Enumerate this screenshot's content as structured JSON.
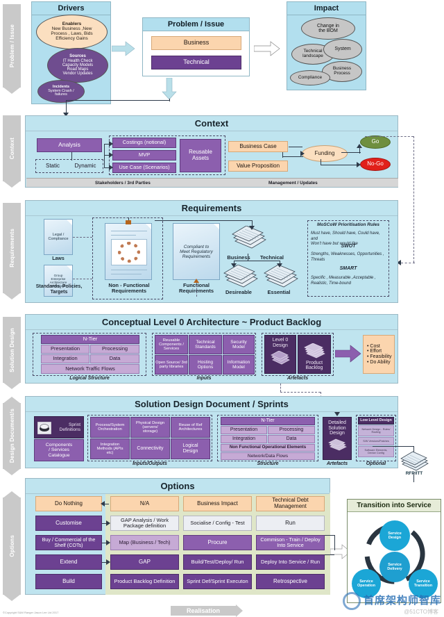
{
  "phases": [
    {
      "key": "problem-issue",
      "label": "Problem / Issue"
    },
    {
      "key": "context",
      "label": "Context"
    },
    {
      "key": "requirements",
      "label": "Requirements"
    },
    {
      "key": "solution-design",
      "label": "Solution Design"
    },
    {
      "key": "design-documents",
      "label": "Design Document/s"
    },
    {
      "key": "options",
      "label": "Options"
    }
  ],
  "drivers": {
    "title": "Drivers",
    "clouds": [
      {
        "heading": "Enablers",
        "lines": [
          "New Business ,New",
          "Process , Laws, Bids",
          "Efficiency Gains"
        ]
      },
      {
        "heading": "Sources",
        "lines": [
          "IT Health Check",
          "Capacity Models",
          "Road Maps",
          "Vendor Updates"
        ]
      },
      {
        "heading": "Incidents",
        "lines": [
          "System Crash /",
          "failures"
        ]
      }
    ]
  },
  "problem_issue": {
    "title": "Problem / Issue",
    "items": [
      {
        "label": "Business",
        "style": "peach"
      },
      {
        "label": "Technical",
        "style": "purple"
      }
    ]
  },
  "impact": {
    "title": "Impact",
    "clouds": [
      {
        "lines": [
          "Change in",
          "the BOM"
        ]
      },
      {
        "lines": [
          "Technical",
          "landscape"
        ]
      },
      {
        "lines": [
          "System"
        ]
      },
      {
        "lines": [
          "Business",
          "Process"
        ]
      },
      {
        "lines": [
          "Compliance"
        ]
      }
    ]
  },
  "context": {
    "title": "Context",
    "analysis": "Analysis",
    "static": "Static",
    "dynamic": "Dynamic",
    "group_items": [
      "Costings (notional)",
      "MVP",
      "Use Case (Scenarios)"
    ],
    "reusable_assets": [
      "Reusable",
      "Assets"
    ],
    "business_case": "Business Case",
    "value_proposition": "Value Proposition",
    "funding": "Funding",
    "go": "Go",
    "no_go": "No-Go",
    "footer_left": "Stakeholders / 3rd Parties",
    "footer_right": "Management / Updates"
  },
  "requirements": {
    "title": "Requirements",
    "docs_left": [
      {
        "body": [
          "Legal /",
          "Compliance"
        ],
        "caption": [
          "Laws"
        ]
      },
      {
        "body": [
          "Group",
          "Enterprise",
          "Architecture",
          "Directives"
        ],
        "caption": [
          "Standards, Policies,",
          "Targets"
        ]
      }
    ],
    "nfr_caption": [
      "Non - Functional",
      "Requirements"
    ],
    "fr_body": [
      "Compliant to",
      "Meet Regulatory",
      "Requirements"
    ],
    "fr_caption": [
      "Functional",
      "Requirements"
    ],
    "stacks": [
      {
        "label": "Business"
      },
      {
        "label": "Technical"
      },
      {
        "label": "Desireable"
      },
      {
        "label": "Essential"
      }
    ],
    "rules": {
      "title": "MoSCoW Prioritisation Rules",
      "moscow": [
        "Must have, Should have, Could have, and",
        "Won't have but would like"
      ],
      "swot_title": "SWOT",
      "swot": [
        "Strengths, Weaknesses, Opportunities ,",
        "Threats"
      ],
      "smart_title": "SMART",
      "smart": [
        "Specific , Measurable ,Acceptable ,",
        "Realistic, Time-bound"
      ]
    }
  },
  "conceptual": {
    "title": "Conceptual Level 0 Architecture ~ Product Backlog",
    "ntier_header": "N-Tier",
    "ntier_cells": [
      "Presentation",
      "Processing",
      "Integration",
      "Data"
    ],
    "network_flows": "Network Traffic Flows",
    "logical_label": "Logical Structure",
    "inputs": [
      [
        "Reusable",
        "Components /",
        "Services"
      ],
      [
        "Technical",
        "Standards"
      ],
      [
        "Security",
        "Model"
      ],
      [
        "Open Source/ 3rd",
        "party libraries"
      ],
      [
        "Hosting",
        "Options"
      ],
      [
        "Information",
        "Model"
      ]
    ],
    "inputs_label": "Inputs",
    "artefacts": [
      {
        "lines": [
          "Level 0",
          "Design"
        ]
      },
      {
        "lines": [
          "Product",
          "Backlog"
        ]
      }
    ],
    "artefacts_label": "Artefacts",
    "criteria": [
      "Cost",
      "Effort",
      "Feasibility",
      "Do Ability"
    ]
  },
  "sdd": {
    "title": "Solution Design Document / Sprints",
    "sprint_definitions": [
      "Sprint",
      "Definitions"
    ],
    "components_catalogue": [
      "Components",
      "/ Services",
      "Catalogue"
    ],
    "inputs_outputs": [
      [
        "Process/System",
        "Orchestration"
      ],
      [
        "Physical Design",
        "(servers/",
        "storage)"
      ],
      [
        "Reuse of Ref",
        "Architectures"
      ],
      [
        "Integration",
        "Methods (APIs",
        "etc)"
      ],
      [
        "Connectivity"
      ],
      [
        "Logical",
        "Design"
      ]
    ],
    "inputs_outputs_label": "Inputs/Outputs",
    "ntier_header": "N-Tier",
    "ntier_cells": [
      "Presentation",
      "Processing",
      "Integration",
      "Data"
    ],
    "nfoe": "Non Functional Operational Elements",
    "network_data_flows": "Network/Data Flows",
    "structure_label": "Structure",
    "detailed_design": [
      "Detailed",
      "Solution",
      "Design"
    ],
    "artefacts_label": "Artefacts",
    "lld_title": "Low Level Design",
    "lld_items": [
      [
        "Network Design - Rules/",
        "Routing"
      ],
      [
        "S/W Versions/Patches"
      ],
      [
        "Software Elements,",
        "Device Config"
      ]
    ],
    "optional_label": "Optional",
    "rfp_label": "RFP/ITT"
  },
  "options": {
    "title": "Options",
    "rows": [
      {
        "option": "Do Nothing",
        "opt_style": "peach",
        "cells": [
          {
            "label": "N/A",
            "style": "peach"
          },
          {
            "label": "Business Impact",
            "style": "peach"
          },
          {
            "label": "Technical Debt Management",
            "style": "peach"
          }
        ]
      },
      {
        "option": "Customise",
        "opt_style": "purple",
        "cells": [
          {
            "label": "GAP Analysis / Work Package definition",
            "style": "white"
          },
          {
            "label": "Socialise / Config - Test",
            "style": "white"
          },
          {
            "label": "Run",
            "style": "white"
          }
        ]
      },
      {
        "option": "Buy / Commercial of the Shelf (COTs)",
        "opt_style": "purple",
        "cells": [
          {
            "label": "Map (Business / Tech)",
            "style": "lilac"
          },
          {
            "label": "Procure",
            "style": "purple2"
          },
          {
            "label": "Commison - Train / Deploy Into Service",
            "style": "purple2"
          }
        ]
      },
      {
        "option": "Extend",
        "opt_style": "purple",
        "cells": [
          {
            "label": "GAP",
            "style": "purple"
          },
          {
            "label": "Build/Test/Deploy/ Run",
            "style": "purple"
          },
          {
            "label": "Deploy Into Service / Run",
            "style": "purple"
          }
        ]
      },
      {
        "option": "Build",
        "opt_style": "purple",
        "cells": [
          {
            "label": "Product Backlog Definition",
            "style": "purple"
          },
          {
            "label": "Sprint Def/Sprint Executon",
            "style": "purple"
          },
          {
            "label": "Retrospective",
            "style": "purple"
          }
        ]
      }
    ]
  },
  "transition": {
    "title": "Transition into Service",
    "nodes": [
      {
        "lines": [
          "Service",
          "Design"
        ]
      },
      {
        "lines": [
          "Service",
          "Delivery"
        ]
      },
      {
        "lines": [
          "Service",
          "Operation"
        ]
      },
      {
        "lines": [
          "Service",
          "Transition"
        ]
      }
    ]
  },
  "footer": {
    "realisation": "Realisation",
    "copyright": "©Copyright S&M Ranger Jason Lee Ltd 2017"
  },
  "watermark": {
    "text": "首席架构师智库",
    "sub": "@51CTO博客"
  },
  "colors": {
    "panel": "#bfe4ef",
    "peach": "#fbd5ae",
    "purple": "#6c4191",
    "dark_purple": "#4b2d63",
    "go_green": "#6f8f3f",
    "nogo_red": "#e1201a",
    "options_band": "#dfe6c8",
    "phase_grey": "#c9c9c9"
  }
}
